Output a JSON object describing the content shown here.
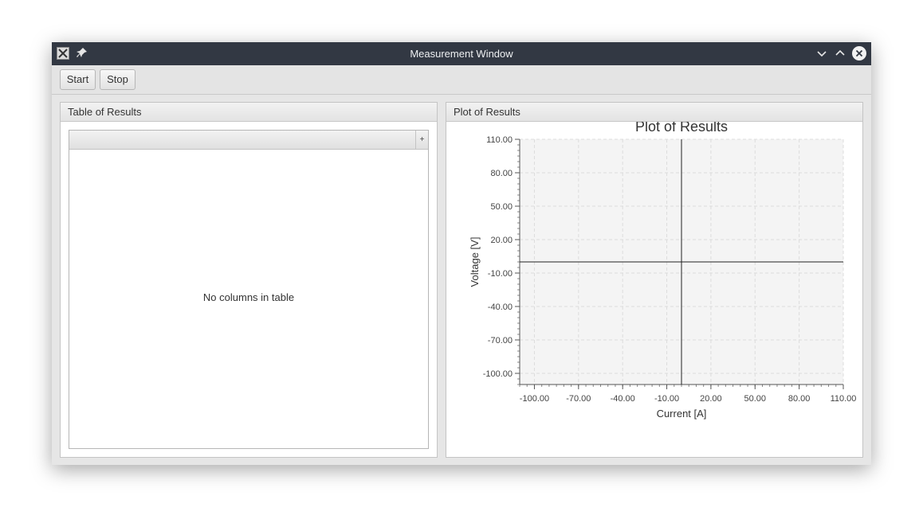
{
  "window": {
    "title": "Measurement Window",
    "app_icon": "app-icon",
    "pin_icon": "pin-icon",
    "minimize_icon": "chevron-down-icon",
    "maximize_icon": "chevron-up-icon",
    "close_icon": "close-icon"
  },
  "toolbar": {
    "start_label": "Start",
    "stop_label": "Stop"
  },
  "table_panel": {
    "title": "Table of Results",
    "empty_message": "No columns in table",
    "menu_button_icon": "plus-icon",
    "menu_button_glyph": "+"
  },
  "plot_panel": {
    "title": "Plot of Results"
  },
  "chart_data": {
    "type": "scatter",
    "title": "Plot of Results",
    "xlabel": "Current [A]",
    "ylabel": "Voltage [V]",
    "xlim": [
      -110,
      110
    ],
    "ylim": [
      -110,
      110
    ],
    "x_ticks": [
      "-100.00",
      "-70.00",
      "-40.00",
      "-10.00",
      "20.00",
      "50.00",
      "80.00",
      "110.00"
    ],
    "y_ticks": [
      "110.00",
      "80.00",
      "50.00",
      "20.00",
      "-10.00",
      "-40.00",
      "-70.00",
      "-100.00"
    ],
    "grid": true,
    "series": []
  },
  "colors": {
    "titlebar": "#323843",
    "plot_background": "#f4f4f4",
    "grid": "#dcdcdc",
    "axis": "#555555"
  }
}
